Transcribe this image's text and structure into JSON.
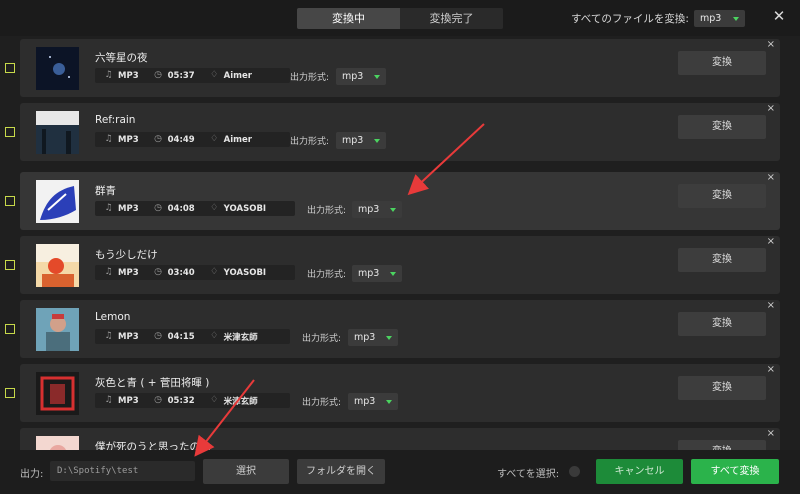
{
  "header": {
    "tabs": [
      {
        "label": "変換中",
        "active": true
      },
      {
        "label": "変換完了",
        "active": false
      }
    ],
    "convert_all_label": "すべてのファイルを変換:",
    "convert_all_format": "mp3",
    "close_glyph": "✕"
  },
  "row_common": {
    "format_label": "出力形式:",
    "convert_label": "変換",
    "close_glyph": "×"
  },
  "rows": [
    {
      "title": "六等星の夜",
      "format": "MP3",
      "duration": "05:37",
      "artist": "Aimer",
      "output": "mp3"
    },
    {
      "title": "Ref:rain",
      "format": "MP3",
      "duration": "04:49",
      "artist": "Aimer",
      "output": "mp3"
    },
    {
      "title": "群青",
      "format": "MP3",
      "duration": "04:08",
      "artist": "YOASOBI",
      "output": "mp3"
    },
    {
      "title": "もう少しだけ",
      "format": "MP3",
      "duration": "03:40",
      "artist": "YOASOBI",
      "output": "mp3"
    },
    {
      "title": "Lemon",
      "format": "MP3",
      "duration": "04:15",
      "artist": "米津玄師",
      "output": "mp3"
    },
    {
      "title": "灰色と青 ( + 菅田将暉 )",
      "format": "MP3",
      "duration": "05:32",
      "artist": "米津玄師",
      "output": "mp3"
    },
    {
      "title": "僕が死のうと思ったのは",
      "format": "",
      "duration": "",
      "artist": "",
      "output": ""
    }
  ],
  "footer": {
    "output_label": "出力:",
    "output_path": "D:\\Spotify\\test",
    "choose_label": "選択",
    "open_folder_label": "フォルダを開く",
    "select_all_label": "すべてを選択:",
    "cancel_label": "キャンセル",
    "convert_all_label": "すべて変換"
  },
  "colors": {
    "accent_green": "#2bb34b",
    "checkbox": "#c7d94a",
    "annotation_arrow": "#e83a3a"
  }
}
